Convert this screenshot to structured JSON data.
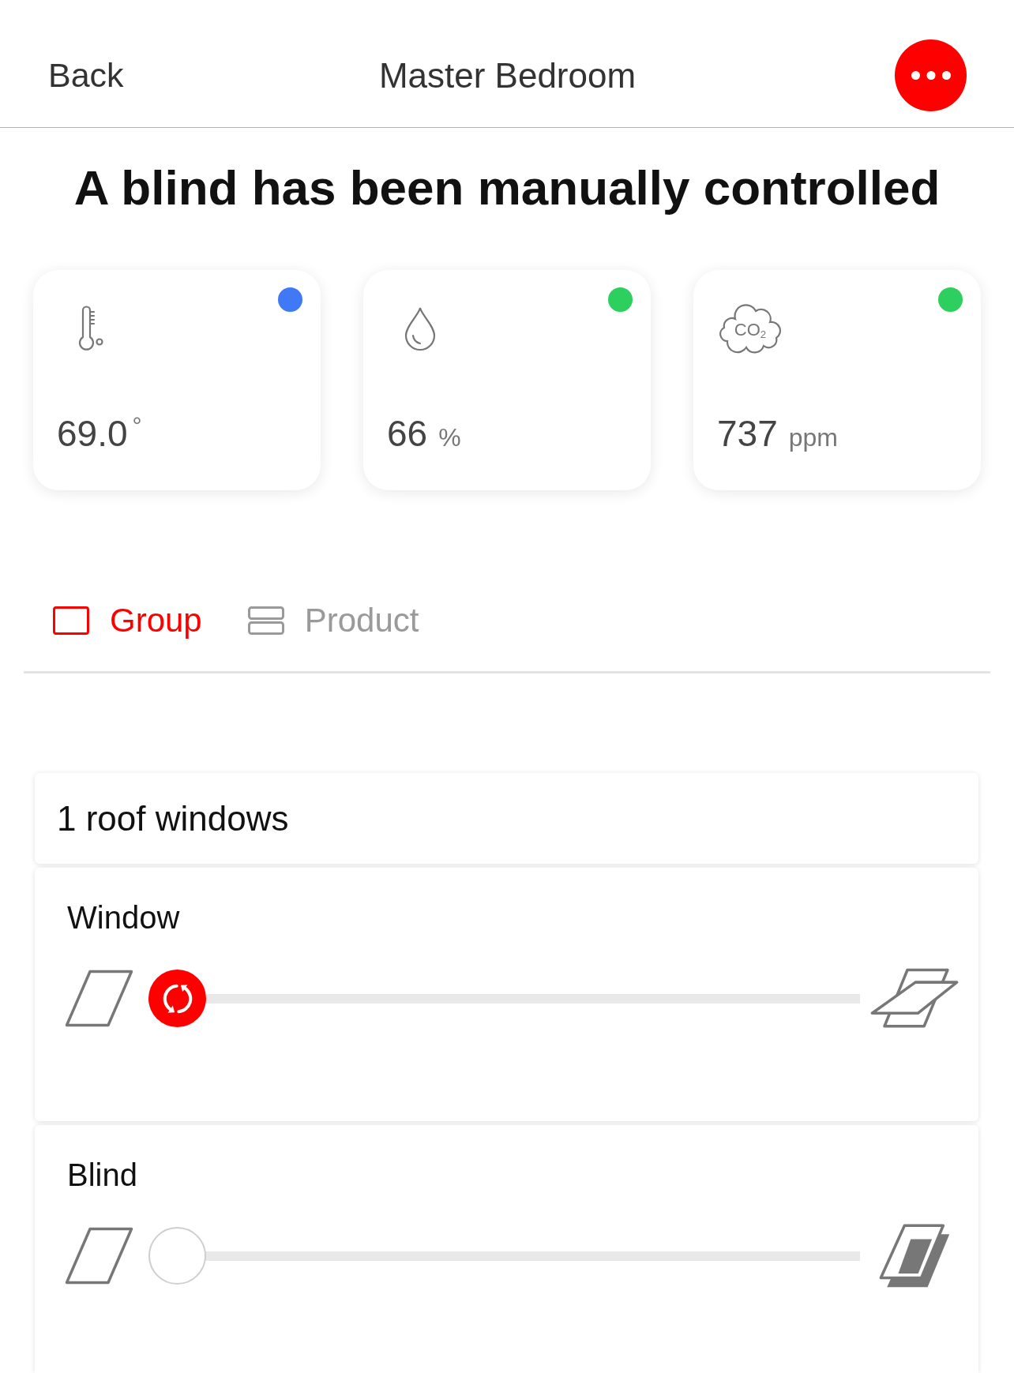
{
  "header": {
    "back": "Back",
    "title": "Master Bedroom"
  },
  "alert": {
    "message": "A blind has been manually controlled"
  },
  "sensors": [
    {
      "kind": "temperature",
      "value": "69.0",
      "unit": "°",
      "color": "#4079f5"
    },
    {
      "kind": "humidity",
      "value": "66",
      "unit": "%",
      "color": "#2dcf5e"
    },
    {
      "kind": "co2",
      "icon_text": "CO$_{2}$",
      "value": "737",
      "unit": "ppm",
      "color": "#2dcf5e"
    }
  ],
  "tabs": [
    {
      "kind": "group",
      "label": "Group",
      "selected": true
    },
    {
      "kind": "product",
      "label": "Product",
      "selected": false
    }
  ],
  "group": {
    "title": "1 roof windows",
    "products": [
      {
        "kind": "window",
        "label": "Window",
        "level": 0,
        "moving": true
      },
      {
        "kind": "blind",
        "label": "Blind",
        "level": 0,
        "moving": false
      }
    ]
  }
}
